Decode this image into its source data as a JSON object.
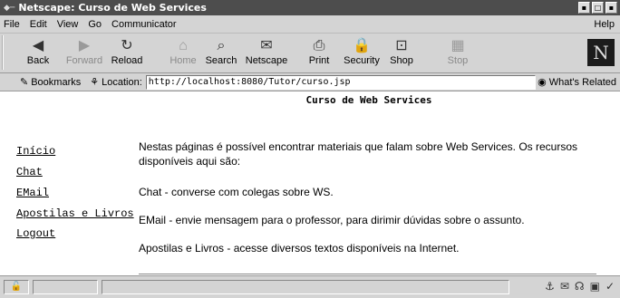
{
  "window": {
    "title": "Netscape: Curso de Web Services"
  },
  "menu": [
    "File",
    "Edit",
    "View",
    "Go",
    "Communicator"
  ],
  "menu_help": "Help",
  "toolbar": [
    {
      "label": "Back",
      "icon": "back-arrow-icon",
      "disabled": false
    },
    {
      "label": "Forward",
      "icon": "forward-arrow-icon",
      "disabled": true
    },
    {
      "label": "Reload",
      "icon": "reload-icon",
      "disabled": false
    },
    {
      "label": "Home",
      "icon": "home-icon",
      "disabled": true
    },
    {
      "label": "Search",
      "icon": "search-icon",
      "disabled": false
    },
    {
      "label": "Netscape",
      "icon": "netscape-icon",
      "disabled": false
    },
    {
      "label": "Print",
      "icon": "print-icon",
      "disabled": false
    },
    {
      "label": "Security",
      "icon": "security-lock-icon",
      "disabled": false
    },
    {
      "label": "Shop",
      "icon": "shop-icon",
      "disabled": false
    },
    {
      "label": "Stop",
      "icon": "stop-icon",
      "disabled": true
    }
  ],
  "location": {
    "bookmarks_label": "Bookmarks",
    "location_label": "Location:",
    "url": "http://localhost:8080/Tutor/curso.jsp",
    "related_label": "What's Related"
  },
  "page": {
    "title": "Curso de Web Services",
    "nav": [
      "Início",
      "Chat",
      "EMail",
      "Apostilas e Livros",
      "Logout"
    ],
    "intro": "Nestas páginas é possível encontrar materiais que falam sobre Web Services. Os recursos disponíveis aqui são:",
    "items": [
      "Chat - converse com colegas sobre WS.",
      "EMail - envie mensagem para o professor, para dirimir dúvidas sobre o assunto.",
      "Apostilas e Livros - acesse diversos textos disponíveis na Internet."
    ]
  }
}
